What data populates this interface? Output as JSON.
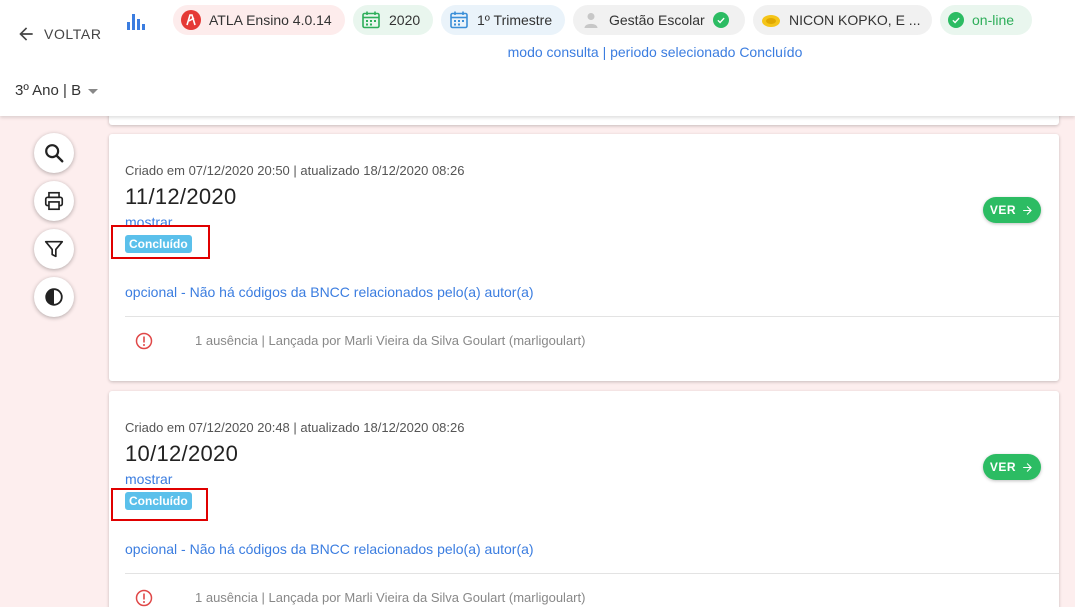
{
  "header": {
    "back_label": "VOLTAR",
    "chips": {
      "app": "ATLA Ensino 4.0.14",
      "year": "2020",
      "term": "1º Trimestre",
      "role": "Gestão Escolar",
      "user": "NICON KOPKO, E ...",
      "status": "on-line"
    },
    "mode_text": "modo consulta | periodo selecionado Concluído",
    "class_label": "3º Ano | B"
  },
  "colors": {
    "accent_blue": "#3b7de0",
    "success_green": "#2cbc63",
    "badge_blue": "#5bc0eb",
    "highlight_red": "#e00000",
    "background": "#fdeeee"
  },
  "tools": [
    "search-icon",
    "print-icon",
    "filter-icon",
    "contrast-icon"
  ],
  "cards": [
    {
      "meta": "Criado em 07/12/2020 20:50 | atualizado 18/12/2020 08:26",
      "date": "11/12/2020",
      "show_label": "mostrar",
      "status": "Concluído",
      "bncc": "opcional - Não há códigos da BNCC relacionados pelo(a) autor(a)",
      "absence": "1 ausência | Lançada por Marli Vieira da Silva Goulart (marligoulart)",
      "ver_label": "VER"
    },
    {
      "meta": "Criado em 07/12/2020 20:48 | atualizado 18/12/2020 08:26",
      "date": "10/12/2020",
      "show_label": "mostrar",
      "status": "Concluído",
      "bncc": "opcional - Não há códigos da BNCC relacionados pelo(a) autor(a)",
      "absence": "1 ausência | Lançada por Marli Vieira da Silva Goulart (marligoulart)",
      "ver_label": "VER"
    }
  ]
}
